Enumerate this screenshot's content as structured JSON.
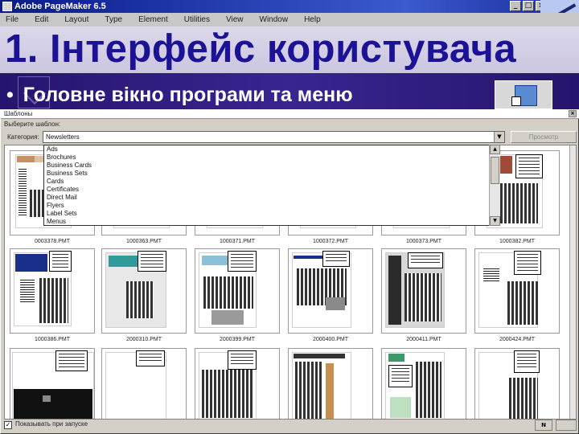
{
  "app": {
    "title": "Adobe PageMaker 6.5",
    "minimize": "_",
    "maximize": "□",
    "close": "×"
  },
  "menu": [
    "File",
    "Edit",
    "Layout",
    "Type",
    "Element",
    "Utilities",
    "View",
    "Window",
    "Help"
  ],
  "slide": {
    "title": "1. Інтерфейс користувача",
    "bullet": "•",
    "subtitle": "Головне вікно програми та меню"
  },
  "dialog": {
    "title": "Шаблоны",
    "close": "×",
    "templates_label": "Выберите шаблон:",
    "category_label": "Категория:",
    "category_value": "Newsletters",
    "dropdown_arrow": "▼",
    "preview_button": "Просмотр",
    "category_options": [
      "Ads",
      "Brochures",
      "Business Cards",
      "Business Sets",
      "Cards",
      "Certificates",
      "Direct Mail",
      "Flyers",
      "Label Sets",
      "Menus"
    ],
    "scroll_up": "▲",
    "scroll_down": "▼",
    "thumbnails": [
      {
        "label": "0003378.PMT"
      },
      {
        "label": "1000363.PMT"
      },
      {
        "label": "1000371.PMT"
      },
      {
        "label": "1000372.PMT"
      },
      {
        "label": "1000373.PMT"
      },
      {
        "label": "1000382.PMT"
      },
      {
        "label": "1000386.PMT"
      },
      {
        "label": "2000310.PMT"
      },
      {
        "label": "2000399.PMT"
      },
      {
        "label": "2000400.PMT"
      },
      {
        "label": "2000411.PMT"
      },
      {
        "label": "2000424.PMT"
      },
      {
        "label": ""
      },
      {
        "label": ""
      },
      {
        "label": ""
      },
      {
        "label": ""
      },
      {
        "label": ""
      },
      {
        "label": ""
      }
    ],
    "show_on_start_check": "✓",
    "show_on_start_label": "Показывать при запуске",
    "status_indicator": "N"
  },
  "colors": {
    "title_text": "#1b1296",
    "subtitle_band": "#3a2590",
    "blue_block": "#1a2f8a",
    "teal_block": "#2f9a9a",
    "brick_block": "#a04a3a"
  }
}
